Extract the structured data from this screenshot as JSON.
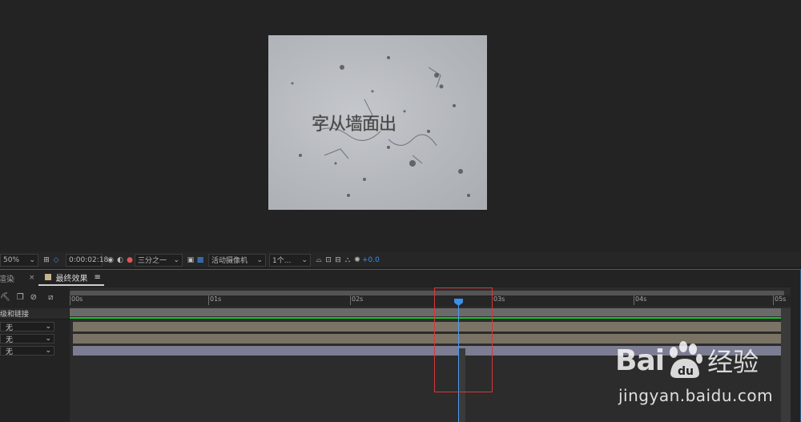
{
  "composition": {
    "preview_text": "字从墙面出"
  },
  "viewer_bar": {
    "zoom": "50%",
    "timecode": "0:00:02:18",
    "resolution": "三分之一",
    "camera": "活动摄像机",
    "views": "1个...",
    "exposure": "+0.0"
  },
  "timeline": {
    "tabs": [
      {
        "label": "渲染"
      },
      {
        "label": "最终效果"
      }
    ],
    "column_header": "级和链接",
    "layers": [
      {
        "parent": "无"
      },
      {
        "parent": "无"
      },
      {
        "parent": "无"
      }
    ],
    "ruler_ticks": [
      "00s",
      "01s",
      "02s",
      "03s",
      "04s",
      "05s"
    ],
    "playhead_time": "0:00:02:18",
    "colors": {
      "layer_tan": "#7b7466",
      "layer_tan2": "#7a7264",
      "layer_purple": "#7c7c92",
      "green": "#16c12a",
      "playhead": "#3d8ee6",
      "highlight": "#d8373a"
    }
  },
  "watermark": {
    "brand": "Bai",
    "brand_suffix": "经验",
    "url": "jingyan.baidu.com"
  }
}
